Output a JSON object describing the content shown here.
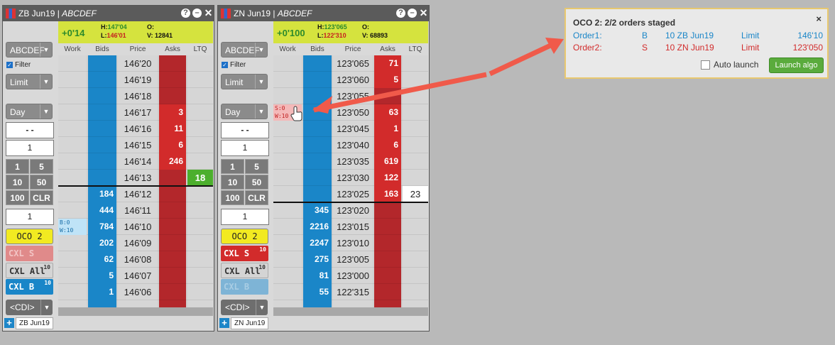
{
  "windows": [
    {
      "title": "ZB Jun19",
      "account": "ABCDEF",
      "change": "+0'14",
      "high_label": "H:",
      "high": "147'04",
      "low_label": "L:",
      "low": "146'01",
      "open_label": "O:",
      "open": "",
      "volume_label": "V:",
      "volume": "12841",
      "account_select": "ABCDEF",
      "filter_label": "Filter",
      "order_type": "Limit",
      "tif": "Day",
      "price_box": "- -",
      "qty_box": "1",
      "qty_buttons": [
        "1",
        "5",
        "10",
        "50",
        "100",
        "CLR"
      ],
      "qty_box2": "1",
      "oco_label": "OCO 2",
      "cxl_s": "CXL S",
      "cxl_s_sup": "",
      "cxl_all": "CXL All",
      "cxl_all_sup": "10",
      "cxl_b": "CXL B",
      "cxl_b_sup": "10",
      "cdi": "<CDI>",
      "tab": "ZB Jun19",
      "columns": [
        "Work",
        "Bids",
        "Price",
        "Asks",
        "LTQ"
      ],
      "rows": [
        {
          "price": "146'20",
          "bid": "",
          "ask": "",
          "ltq": "",
          "work": ""
        },
        {
          "price": "146'19",
          "bid": "",
          "ask": "",
          "ltq": "",
          "work": ""
        },
        {
          "price": "146'18",
          "bid": "",
          "ask": "",
          "ltq": "",
          "work": ""
        },
        {
          "price": "146'17",
          "bid": "",
          "ask": "3",
          "ltq": "",
          "work": ""
        },
        {
          "price": "146'16",
          "bid": "",
          "ask": "11",
          "ltq": "",
          "work": ""
        },
        {
          "price": "146'15",
          "bid": "",
          "ask": "6",
          "ltq": "",
          "work": ""
        },
        {
          "price": "146'14",
          "bid": "",
          "ask": "246",
          "ltq": "",
          "work": ""
        },
        {
          "price": "146'13",
          "bid": "",
          "ask": "",
          "ltq": "18",
          "work": ""
        },
        {
          "price": "146'12",
          "bid": "184",
          "ask": "",
          "ltq": "",
          "work": ""
        },
        {
          "price": "146'11",
          "bid": "444",
          "ask": "",
          "ltq": "",
          "work": ""
        },
        {
          "price": "146'10",
          "bid": "784",
          "ask": "",
          "ltq": "",
          "work": "B:0\nW:10"
        },
        {
          "price": "146'09",
          "bid": "202",
          "ask": "",
          "ltq": "",
          "work": ""
        },
        {
          "price": "146'08",
          "bid": "62",
          "ask": "",
          "ltq": "",
          "work": ""
        },
        {
          "price": "146'07",
          "bid": "5",
          "ask": "",
          "ltq": "",
          "work": ""
        },
        {
          "price": "146'06",
          "bid": "1",
          "ask": "",
          "ltq": "",
          "work": ""
        }
      ]
    },
    {
      "title": "ZN Jun19",
      "account": "ABCDEF",
      "change": "+0'100",
      "high_label": "H:",
      "high": "123'065",
      "low_label": "L:",
      "low": "122'310",
      "open_label": "O:",
      "open": "",
      "volume_label": "V:",
      "volume": "68893",
      "account_select": "ABCDEF",
      "filter_label": "Filter",
      "order_type": "Limit",
      "tif": "Day",
      "price_box": "- -",
      "qty_box": "1",
      "qty_buttons": [
        "1",
        "5",
        "10",
        "50",
        "100",
        "CLR"
      ],
      "qty_box2": "1",
      "oco_label": "OCO 2",
      "cxl_s": "CXL S",
      "cxl_s_sup": "10",
      "cxl_all": "CXL All",
      "cxl_all_sup": "10",
      "cxl_b": "CXL B",
      "cxl_b_sup": "",
      "cdi": "<CDI>",
      "tab": "ZN Jun19",
      "columns": [
        "Work",
        "Bids",
        "Price",
        "Asks",
        "LTQ"
      ],
      "rows": [
        {
          "price": "123'065",
          "bid": "",
          "ask": "71",
          "ltq": "",
          "work": ""
        },
        {
          "price": "123'060",
          "bid": "",
          "ask": "5",
          "ltq": "",
          "work": ""
        },
        {
          "price": "123'055",
          "bid": "",
          "ask": "",
          "ltq": "",
          "work": ""
        },
        {
          "price": "123'050",
          "bid": "",
          "ask": "63",
          "ltq": "",
          "work": "S:0\nW:10"
        },
        {
          "price": "123'045",
          "bid": "",
          "ask": "1",
          "ltq": "",
          "work": ""
        },
        {
          "price": "123'040",
          "bid": "",
          "ask": "6",
          "ltq": "",
          "work": ""
        },
        {
          "price": "123'035",
          "bid": "",
          "ask": "619",
          "ltq": "",
          "work": ""
        },
        {
          "price": "123'030",
          "bid": "",
          "ask": "122",
          "ltq": "",
          "work": ""
        },
        {
          "price": "123'025",
          "bid": "",
          "ask": "163",
          "ltq": "23",
          "work": ""
        },
        {
          "price": "123'020",
          "bid": "345",
          "ask": "",
          "ltq": "",
          "work": ""
        },
        {
          "price": "123'015",
          "bid": "2216",
          "ask": "",
          "ltq": "",
          "work": ""
        },
        {
          "price": "123'010",
          "bid": "2247",
          "ask": "",
          "ltq": "",
          "work": ""
        },
        {
          "price": "123'005",
          "bid": "275",
          "ask": "",
          "ltq": "",
          "work": ""
        },
        {
          "price": "123'000",
          "bid": "81",
          "ask": "",
          "ltq": "",
          "work": ""
        },
        {
          "price": "122'315",
          "bid": "55",
          "ask": "",
          "ltq": "",
          "work": ""
        }
      ]
    }
  ],
  "oco_panel": {
    "title": "OCO 2: 2/2 orders staged",
    "close": "×",
    "orders": [
      {
        "label": "Order1:",
        "side": "B",
        "desc": "10 ZB Jun19",
        "type": "Limit",
        "price": "146'10",
        "color": "#1a86c8"
      },
      {
        "label": "Order2:",
        "side": "S",
        "desc": "10 ZN Jun19",
        "type": "Limit",
        "price": "123'050",
        "color": "#d22b2b"
      }
    ],
    "auto_launch": "Auto launch",
    "launch": "Launch algo"
  },
  "colors": {
    "bid": "#1a86c8",
    "ask": "#d22b2b",
    "header": "#d5e33e",
    "ltq": "#4caf2d",
    "arrow": "#f05a4a"
  }
}
